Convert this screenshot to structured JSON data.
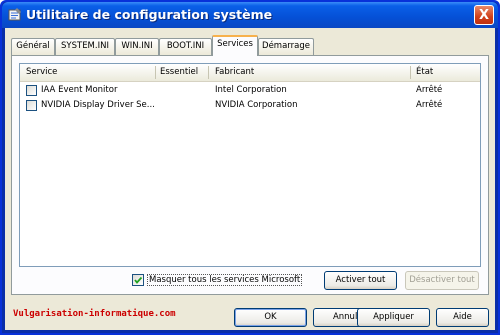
{
  "window": {
    "title": "Utilitaire de configuration système",
    "close_label": "X"
  },
  "tabs": [
    {
      "label": "Général"
    },
    {
      "label": "SYSTEM.INI"
    },
    {
      "label": "WIN.INI"
    },
    {
      "label": "BOOT.INI"
    },
    {
      "label": "Services",
      "active": true
    },
    {
      "label": "Démarrage"
    }
  ],
  "list": {
    "columns": [
      "Service",
      "Essentiel",
      "Fabricant",
      "État"
    ],
    "rows": [
      {
        "service": "IAA Event Monitor",
        "essentiel": "",
        "fabricant": "Intel Corporation",
        "etat": "Arrêté",
        "checked": false
      },
      {
        "service": "NVIDIA Display Driver Se...",
        "essentiel": "",
        "fabricant": "NVIDIA Corporation",
        "etat": "Arrêté",
        "checked": false
      }
    ]
  },
  "options": {
    "hide_microsoft_label": "Masquer tous les services Microsoft",
    "hide_microsoft_checked": true
  },
  "buttons": {
    "enable_all": "Activer tout",
    "disable_all": "Désactiver tout",
    "ok": "OK",
    "cancel": "Annuler",
    "apply": "Appliquer",
    "help": "Aide"
  },
  "watermark": "Vulgarisation-informatique.com",
  "colors": {
    "titlebar": "#0550d6",
    "active_tab_accent": "#f7b14c",
    "watermark": "#cc0000"
  },
  "icons": {
    "title": "msconfig-icon",
    "check": "checkmark-icon"
  }
}
